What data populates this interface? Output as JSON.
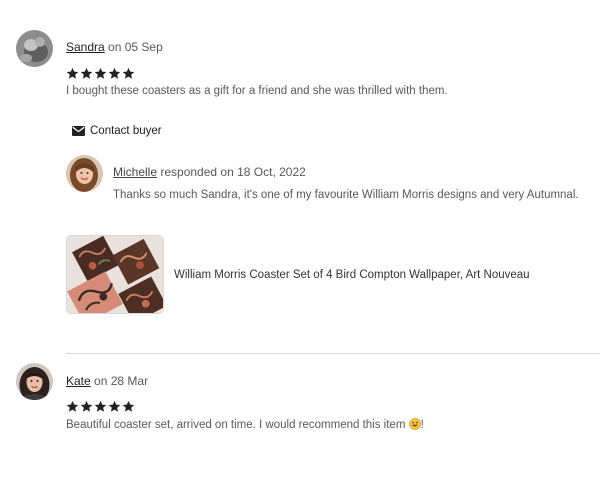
{
  "reviews": [
    {
      "reviewer": "Sandra",
      "date_text": "on 05 Sep",
      "rating": 5,
      "text": "I bought these coasters as a gift for a friend and she was thrilled with them.",
      "contact_label": "Contact buyer",
      "response": {
        "responder": "Michelle",
        "date_text": "responded on 18 Oct, 2022",
        "text": "Thanks so much Sandra, it's one of my favourite William Morris designs and very Autumnal."
      },
      "product": {
        "title": "William Morris Coaster Set of 4 Bird Compton Wallpaper, Art Nouveau"
      }
    },
    {
      "reviewer": "Kate",
      "date_text": "on 28 Mar",
      "rating": 5,
      "text_before_emoji": "Beautiful coaster set, arrived on time. I would recommend this item ",
      "text_after_emoji": "!",
      "emoji_icon": "grinning-face-emoji"
    }
  ],
  "colors": {
    "star": "#222222",
    "emoji": "#f5c33b",
    "divider": "#d5d5d5"
  }
}
